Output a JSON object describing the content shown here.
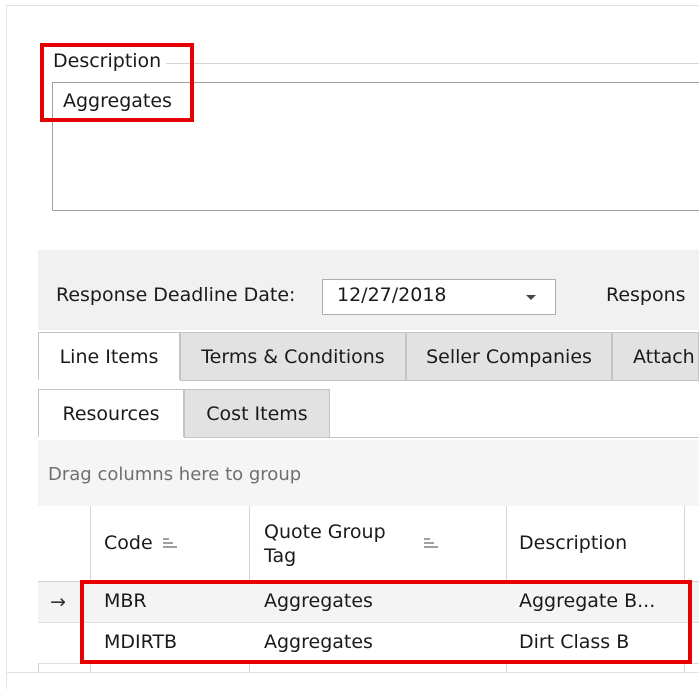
{
  "description": {
    "legend": "Description",
    "value": "Aggregates"
  },
  "deadline": {
    "label": "Response Deadline Date:",
    "value": "12/27/2018",
    "next_label": "Respons"
  },
  "tabs": [
    {
      "label": "Line Items",
      "active": true
    },
    {
      "label": "Terms & Conditions",
      "active": false
    },
    {
      "label": "Seller Companies",
      "active": false
    },
    {
      "label": "Attach",
      "active": false
    }
  ],
  "subtabs": [
    {
      "label": "Resources",
      "active": true
    },
    {
      "label": "Cost Items",
      "active": false
    }
  ],
  "grid": {
    "group_hint": "Drag columns here to group",
    "columns": [
      "Code",
      "Quote Group Tag",
      "Description"
    ],
    "rows": [
      {
        "indicator": "→",
        "code": "MBR",
        "tag": "Aggregates",
        "description": "Aggregate B..."
      },
      {
        "indicator": "",
        "code": "MDIRTB",
        "tag": "Aggregates",
        "description": "Dirt Class B"
      }
    ]
  },
  "colors": {
    "highlight": "#e60000",
    "active_tab": "#ffffff",
    "inactive_tab": "#e2e2e2"
  }
}
